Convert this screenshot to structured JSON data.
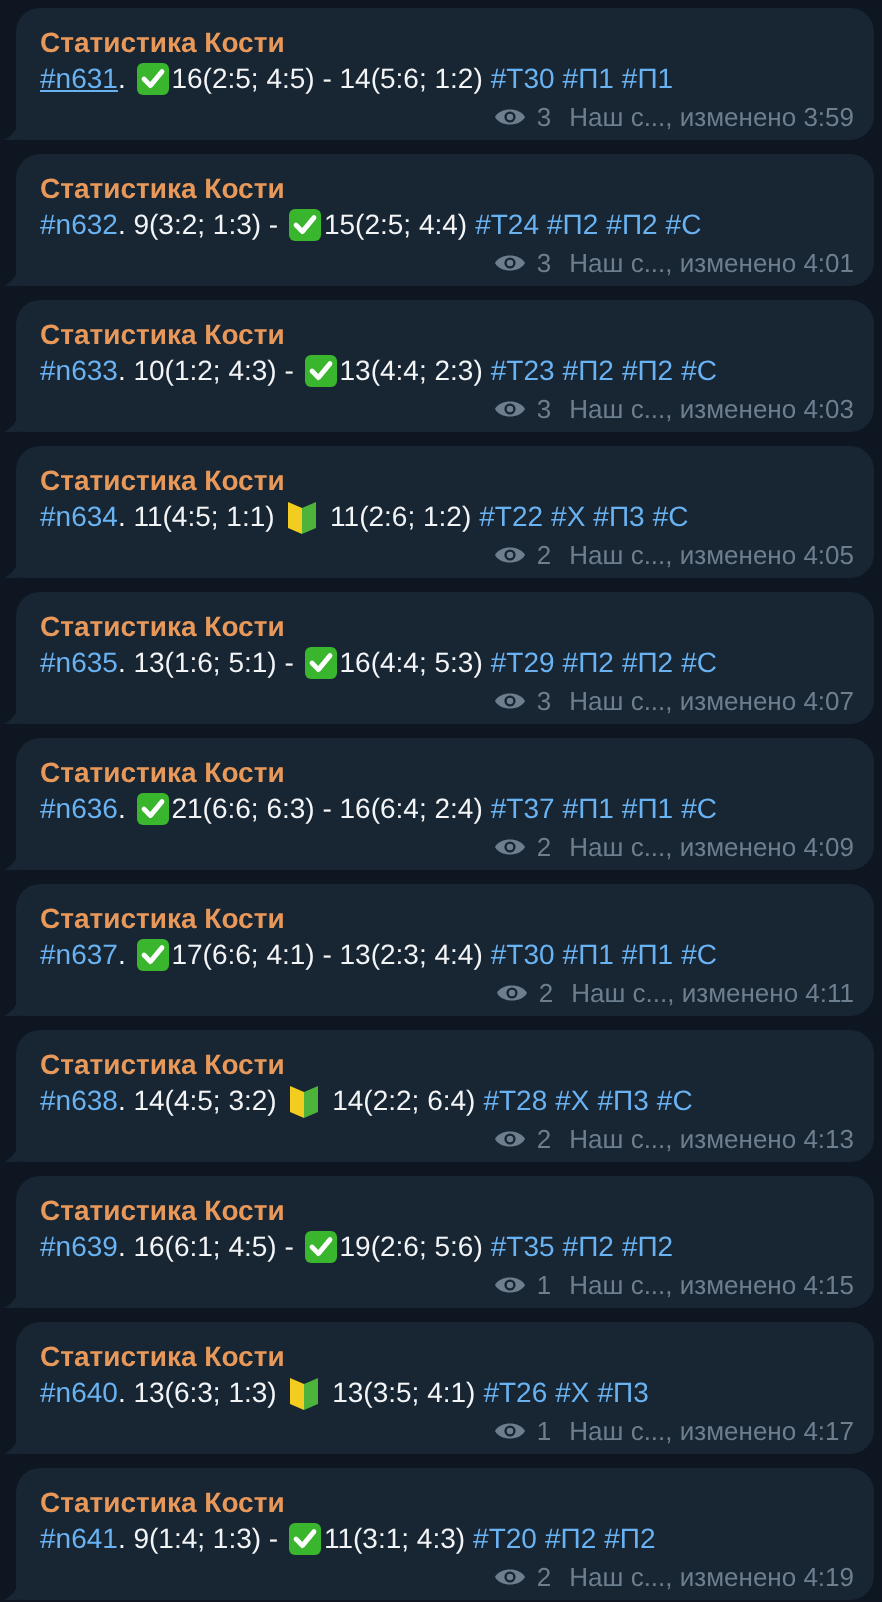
{
  "messages": [
    {
      "sender": "Статистика Кости",
      "id": "#n631",
      "underlined": true,
      "parts": [
        {
          "kind": "text",
          "text": ". "
        },
        {
          "kind": "check"
        },
        {
          "kind": "text",
          "text": "16(2:5; 4:5) - 14(5:6; 1:2)"
        }
      ],
      "tags": [
        "#Т30",
        "#П1",
        "#П1"
      ],
      "views": "3",
      "meta": "Наш с..., изменено 3:59"
    },
    {
      "sender": "Статистика Кости",
      "id": "#n632",
      "underlined": false,
      "parts": [
        {
          "kind": "text",
          "text": ". 9(3:2; 1:3) - "
        },
        {
          "kind": "check"
        },
        {
          "kind": "text",
          "text": "15(2:5; 4:4)"
        }
      ],
      "tags": [
        "#Т24",
        "#П2",
        "#П2",
        "#С"
      ],
      "views": "3",
      "meta": "Наш с..., изменено 4:01"
    },
    {
      "sender": "Статистика Кости",
      "id": "#n633",
      "underlined": false,
      "parts": [
        {
          "kind": "text",
          "text": ". 10(1:2; 4:3) - "
        },
        {
          "kind": "check"
        },
        {
          "kind": "text",
          "text": "13(4:4; 2:3)"
        }
      ],
      "tags": [
        "#Т23",
        "#П2",
        "#П2",
        "#С"
      ],
      "views": "3",
      "meta": "Наш с..., изменено 4:03"
    },
    {
      "sender": "Статистика Кости",
      "id": "#n634",
      "underlined": false,
      "parts": [
        {
          "kind": "text",
          "text": ". 11(4:5; 1:1) "
        },
        {
          "kind": "beginner"
        },
        {
          "kind": "text",
          "text": " 11(2:6; 1:2)"
        }
      ],
      "tags": [
        "#Т22",
        "#Х",
        "#П3",
        "#С"
      ],
      "views": "2",
      "meta": "Наш с..., изменено 4:05"
    },
    {
      "sender": "Статистика Кости",
      "id": "#n635",
      "underlined": false,
      "parts": [
        {
          "kind": "text",
          "text": ". 13(1:6; 5:1) - "
        },
        {
          "kind": "check"
        },
        {
          "kind": "text",
          "text": "16(4:4; 5:3)"
        }
      ],
      "tags": [
        "#Т29",
        "#П2",
        "#П2",
        "#С"
      ],
      "views": "3",
      "meta": "Наш с..., изменено 4:07"
    },
    {
      "sender": "Статистика Кости",
      "id": "#n636",
      "underlined": false,
      "parts": [
        {
          "kind": "text",
          "text": ". "
        },
        {
          "kind": "check"
        },
        {
          "kind": "text",
          "text": "21(6:6; 6:3) - 16(6:4; 2:4)"
        }
      ],
      "tags": [
        "#Т37",
        "#П1",
        "#П1",
        "#С"
      ],
      "views": "2",
      "meta": "Наш с..., изменено 4:09"
    },
    {
      "sender": "Статистика Кости",
      "id": "#n637",
      "underlined": false,
      "parts": [
        {
          "kind": "text",
          "text": ". "
        },
        {
          "kind": "check"
        },
        {
          "kind": "text",
          "text": "17(6:6; 4:1) - 13(2:3; 4:4)"
        }
      ],
      "tags": [
        "#Т30",
        "#П1",
        "#П1",
        "#С"
      ],
      "views": "2",
      "meta": "Наш с..., изменено 4:11"
    },
    {
      "sender": "Статистика Кости",
      "id": "#n638",
      "underlined": false,
      "parts": [
        {
          "kind": "text",
          "text": ". 14(4:5; 3:2) "
        },
        {
          "kind": "beginner"
        },
        {
          "kind": "text",
          "text": " 14(2:2; 6:4)"
        }
      ],
      "tags": [
        "#Т28",
        "#Х",
        "#П3",
        "#С"
      ],
      "views": "2",
      "meta": "Наш с..., изменено 4:13"
    },
    {
      "sender": "Статистика Кости",
      "id": "#n639",
      "underlined": false,
      "parts": [
        {
          "kind": "text",
          "text": ". 16(6:1; 4:5) - "
        },
        {
          "kind": "check"
        },
        {
          "kind": "text",
          "text": "19(2:6; 5:6)"
        }
      ],
      "tags": [
        "#Т35",
        "#П2",
        "#П2"
      ],
      "views": "1",
      "meta": "Наш с..., изменено 4:15"
    },
    {
      "sender": "Статистика Кости",
      "id": "#n640",
      "underlined": false,
      "parts": [
        {
          "kind": "text",
          "text": ". 13(6:3; 1:3) "
        },
        {
          "kind": "beginner"
        },
        {
          "kind": "text",
          "text": " 13(3:5; 4:1)"
        }
      ],
      "tags": [
        "#Т26",
        "#Х",
        "#П3"
      ],
      "views": "1",
      "meta": "Наш с..., изменено 4:17"
    },
    {
      "sender": "Статистика Кости",
      "id": "#n641",
      "underlined": false,
      "parts": [
        {
          "kind": "text",
          "text": ". 9(1:4; 1:3) - "
        },
        {
          "kind": "check"
        },
        {
          "kind": "text",
          "text": "11(3:1; 4:3)"
        }
      ],
      "tags": [
        "#Т20",
        "#П2",
        "#П2"
      ],
      "views": "2",
      "meta": "Наш с..., изменено 4:19"
    }
  ]
}
